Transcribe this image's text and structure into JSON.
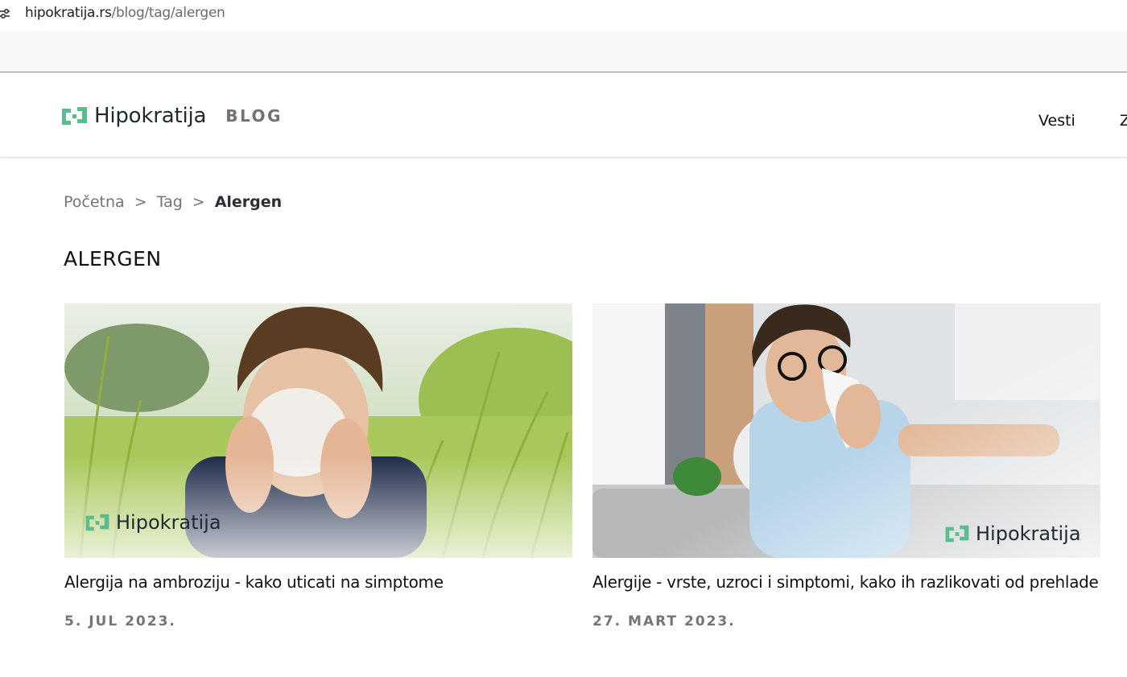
{
  "browser": {
    "url_host": "hipokratija.rs",
    "url_path": "/blog/tag/alergen",
    "site_info_icon": "tune-icon"
  },
  "header": {
    "brand_name": "Hipokratija",
    "blog_label": "BLOG",
    "logo_icon": "hipokratija-logo-icon",
    "nav": [
      "Vesti",
      "Za"
    ]
  },
  "breadcrumb": {
    "items": [
      "Početna",
      "Tag"
    ],
    "separator": ">",
    "current": "Alergen"
  },
  "page_title": "ALERGEN",
  "articles": [
    {
      "title": "Alergija na ambroziju - kako uticati na simptome",
      "date": "5. JUL 2023.",
      "watermark": "Hipokratija",
      "image": "man-sneezing-in-ragweed-field"
    },
    {
      "title": "Alergije - vrste, uzroci i simptomi, kako ih razlikovati od prehlade",
      "date": "27. MART 2023.",
      "watermark": "Hipokratija",
      "image": "man-blowing-nose-on-sofa"
    }
  ],
  "colors": {
    "brand_green": "#5bbd8e",
    "text_dark": "#1f2a30",
    "muted": "#6f767b"
  }
}
